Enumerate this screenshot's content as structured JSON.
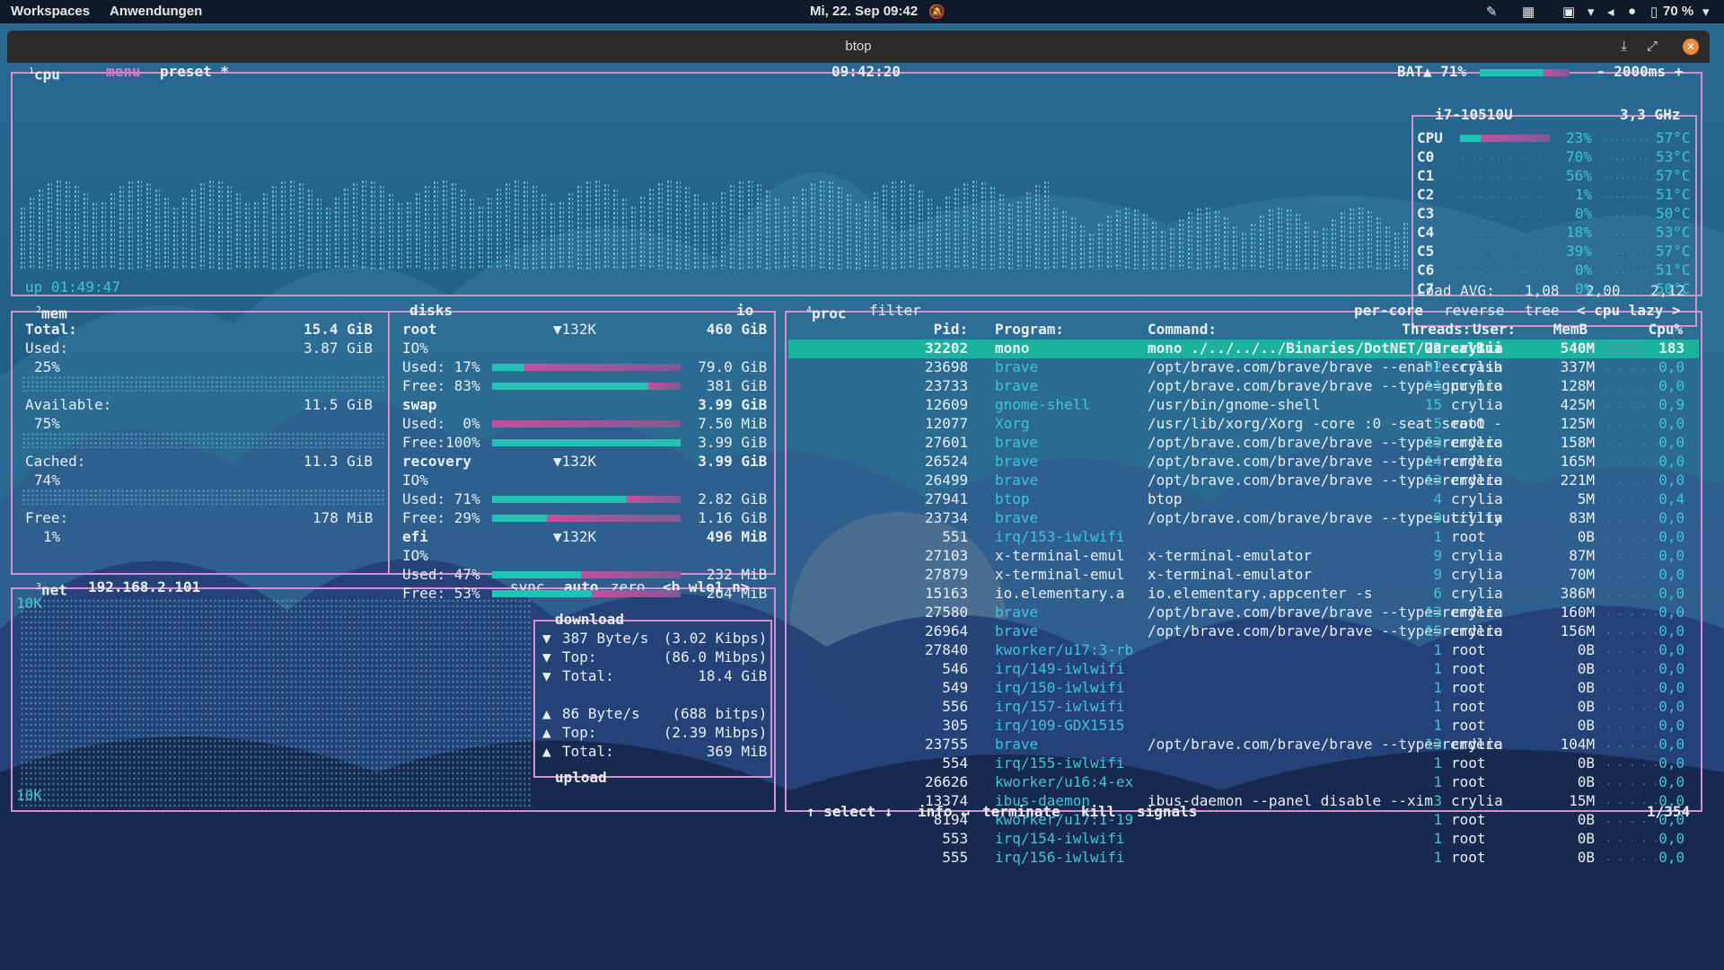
{
  "topbar": {
    "workspaces": "Workspaces",
    "apps": "Anwendungen",
    "clock": "Mi, 22. Sep  09:42",
    "battery": "70 %"
  },
  "window": {
    "title": "btop"
  },
  "cpu": {
    "tabs": [
      "cpu",
      "menu",
      "preset *"
    ],
    "tab_number": "1",
    "time": "09:42:20",
    "battery": "BAT▲ 71%",
    "refresh": "- 2000ms +",
    "uptime": "up 01:49:47",
    "model": "i7-10510U",
    "freq": "3,3 GHz",
    "cores": [
      {
        "name": "CPU",
        "pct": "23%",
        "temp": "57°C"
      },
      {
        "name": "C0",
        "pct": "70%",
        "temp": "53°C"
      },
      {
        "name": "C1",
        "pct": "56%",
        "temp": "57°C"
      },
      {
        "name": "C2",
        "pct": "1%",
        "temp": "51°C"
      },
      {
        "name": "C3",
        "pct": "0%",
        "temp": "50°C"
      },
      {
        "name": "C4",
        "pct": "18%",
        "temp": "53°C"
      },
      {
        "name": "C5",
        "pct": "39%",
        "temp": "57°C"
      },
      {
        "name": "C6",
        "pct": "0%",
        "temp": "51°C"
      },
      {
        "name": "C7",
        "pct": "0%",
        "temp": "50°C"
      }
    ],
    "load_label": "Load AVG:",
    "load": [
      "1,08",
      "2,00",
      "2,12"
    ]
  },
  "mem": {
    "title": "mem",
    "num": "2",
    "total_label": "Total:",
    "total": "15.4 GiB",
    "used_label": "Used:",
    "used": "3.87 GiB",
    "used_pct": "25%",
    "avail_label": "Available:",
    "avail": "11.5 GiB",
    "avail_pct": "75%",
    "cached_label": "Cached:",
    "cached": "11.3 GiB",
    "cached_pct": "74%",
    "free_label": "Free:",
    "free": "178 MiB",
    "free_pct": "1%"
  },
  "disks": {
    "title": "disks",
    "io": "io",
    "items": [
      {
        "name": "root",
        "io_val": "▼132K",
        "size": "460 GiB",
        "io": "IO%",
        "used": "Used: 17%",
        "used_val": "79.0 GiB",
        "used_f": 0.17,
        "free": "Free: 83%",
        "free_val": "381 GiB",
        "free_f": 0.83
      },
      {
        "name": "swap",
        "io_val": "",
        "size": "3.99 GiB",
        "io": "",
        "used": "Used:  0%",
        "used_val": "7.50 MiB",
        "used_f": 0.0,
        "free": "Free:100%",
        "free_val": "3.99 GiB",
        "free_f": 1.0
      },
      {
        "name": "recovery",
        "io_val": "▼132K",
        "size": "3.99 GiB",
        "io": "IO%",
        "used": "Used: 71%",
        "used_val": "2.82 GiB",
        "used_f": 0.71,
        "free": "Free: 29%",
        "free_val": "1.16 GiB",
        "free_f": 0.29
      },
      {
        "name": "efi",
        "io_val": "▼132K",
        "size": "496 MiB",
        "io": "IO%",
        "used": "Used: 47%",
        "used_val": "232 MiB",
        "used_f": 0.47,
        "free": "Free: 53%",
        "free_val": "264 MiB",
        "free_f": 0.53
      }
    ]
  },
  "net": {
    "title": "net",
    "num": "3",
    "ip": "192.168.2.101",
    "buttons": [
      "sync",
      "auto",
      "zero",
      "<b wlo1 n>"
    ],
    "scale_top": "10K",
    "scale_bottom": "10K",
    "download_label": "download",
    "dl_rows": [
      {
        "arrow": "▼",
        "k": "387 Byte/s",
        "v": "(3.02 Kibps)"
      },
      {
        "arrow": "▼",
        "k": "Top:",
        "v": "(86.0 Mibps)"
      },
      {
        "arrow": "▼",
        "k": "Total:",
        "v": "18.4 GiB"
      }
    ],
    "ul_rows": [
      {
        "arrow": "▲",
        "k": "86 Byte/s",
        "v": "(688 bitps)"
      },
      {
        "arrow": "▲",
        "k": "Top:",
        "v": "(2.39 Mibps)"
      },
      {
        "arrow": "▲",
        "k": "Total:",
        "v": "369 MiB"
      }
    ],
    "upload_label": "upload"
  },
  "proc": {
    "title": "proc",
    "num": "4",
    "filter": "filter",
    "options": [
      "per-core",
      "reverse",
      "tree",
      "< cpu lazy >"
    ],
    "headers": {
      "pid": "Pid:",
      "program": "Program:",
      "command": "Command:",
      "threads": "Threads:",
      "user": "User:",
      "mem": "MemB",
      "cpu": "Cpu%"
    },
    "rows": [
      {
        "pid": "32202",
        "prog": "mono",
        "cmd": "mono ./../../../Binaries/DotNET/UnrealBui",
        "thr": "22",
        "user": "crylia",
        "mem": "540M",
        "cpu": "183"
      },
      {
        "pid": "23698",
        "prog": "brave",
        "cmd": "/opt/brave.com/brave/brave --enable-crash",
        "thr": "32",
        "user": "crylia",
        "mem": "337M",
        "cpu": "0,0"
      },
      {
        "pid": "23733",
        "prog": "brave",
        "cmd": "/opt/brave.com/brave/brave --type=gpu-pro",
        "thr": "11",
        "user": "crylia",
        "mem": "128M",
        "cpu": "0,0"
      },
      {
        "pid": "12609",
        "prog": "gnome-shell",
        "cmd": "/usr/bin/gnome-shell",
        "thr": "15",
        "user": "crylia",
        "mem": "425M",
        "cpu": "0,9"
      },
      {
        "pid": "12077",
        "prog": "Xorg",
        "cmd": "/usr/lib/xorg/Xorg -core :0 -seat seat0 -",
        "thr": "5",
        "user": "root",
        "mem": "125M",
        "cpu": "0,0"
      },
      {
        "pid": "27601",
        "prog": "brave",
        "cmd": "/opt/brave.com/brave/brave --type=rendere",
        "thr": "13",
        "user": "crylia",
        "mem": "158M",
        "cpu": "0,0"
      },
      {
        "pid": "26524",
        "prog": "brave",
        "cmd": "/opt/brave.com/brave/brave --type=rendere",
        "thr": "14",
        "user": "crylia",
        "mem": "165M",
        "cpu": "0,0"
      },
      {
        "pid": "26499",
        "prog": "brave",
        "cmd": "/opt/brave.com/brave/brave --type=rendere",
        "thr": "13",
        "user": "crylia",
        "mem": "221M",
        "cpu": "0,0"
      },
      {
        "pid": "27941",
        "prog": "btop",
        "cmd": "btop",
        "thr": "4",
        "user": "crylia",
        "mem": "5M",
        "cpu": "0,4"
      },
      {
        "pid": "23734",
        "prog": "brave",
        "cmd": "/opt/brave.com/brave/brave --type=utility",
        "thr": "9",
        "user": "crylia",
        "mem": "83M",
        "cpu": "0,0"
      },
      {
        "pid": "551",
        "prog": "irq/153-iwlwifi",
        "cmd": "",
        "thr": "1",
        "user": "root",
        "mem": "0B",
        "cpu": "0,0"
      },
      {
        "pid": "27103",
        "prog": "x-terminal-emul",
        "cmd": "x-terminal-emulator",
        "thr": "9",
        "user": "crylia",
        "mem": "87M",
        "cpu": "0,0"
      },
      {
        "pid": "27879",
        "prog": "x-terminal-emul",
        "cmd": "x-terminal-emulator",
        "thr": "9",
        "user": "crylia",
        "mem": "70M",
        "cpu": "0,0"
      },
      {
        "pid": "15163",
        "prog": "io.elementary.a",
        "cmd": "io.elementary.appcenter -s",
        "thr": "6",
        "user": "crylia",
        "mem": "386M",
        "cpu": "0,0"
      },
      {
        "pid": "27580",
        "prog": "brave",
        "cmd": "/opt/brave.com/brave/brave --type=rendere",
        "thr": "13",
        "user": "crylia",
        "mem": "160M",
        "cpu": "0,0"
      },
      {
        "pid": "26964",
        "prog": "brave",
        "cmd": "/opt/brave.com/brave/brave --type=rendere",
        "thr": "15",
        "user": "crylia",
        "mem": "156M",
        "cpu": "0,0"
      },
      {
        "pid": "27840",
        "prog": "kworker/u17:3-rb",
        "cmd": "",
        "thr": "1",
        "user": "root",
        "mem": "0B",
        "cpu": "0,0"
      },
      {
        "pid": "546",
        "prog": "irq/149-iwlwifi",
        "cmd": "",
        "thr": "1",
        "user": "root",
        "mem": "0B",
        "cpu": "0,0"
      },
      {
        "pid": "549",
        "prog": "irq/150-iwlwifi",
        "cmd": "",
        "thr": "1",
        "user": "root",
        "mem": "0B",
        "cpu": "0,0"
      },
      {
        "pid": "556",
        "prog": "irq/157-iwlwifi",
        "cmd": "",
        "thr": "1",
        "user": "root",
        "mem": "0B",
        "cpu": "0,0"
      },
      {
        "pid": "305",
        "prog": "irq/109-GDX1515",
        "cmd": "",
        "thr": "1",
        "user": "root",
        "mem": "0B",
        "cpu": "0,0"
      },
      {
        "pid": "23755",
        "prog": "brave",
        "cmd": "/opt/brave.com/brave/brave --type=rendere",
        "thr": "13",
        "user": "crylia",
        "mem": "104M",
        "cpu": "0,0"
      },
      {
        "pid": "554",
        "prog": "irq/155-iwlwifi",
        "cmd": "",
        "thr": "1",
        "user": "root",
        "mem": "0B",
        "cpu": "0,0"
      },
      {
        "pid": "26626",
        "prog": "kworker/u16:4-ex",
        "cmd": "",
        "thr": "1",
        "user": "root",
        "mem": "0B",
        "cpu": "0,0"
      },
      {
        "pid": "13374",
        "prog": "ibus-daemon",
        "cmd": "ibus-daemon --panel disable --xim",
        "thr": "3",
        "user": "crylia",
        "mem": "15M",
        "cpu": "0,0"
      },
      {
        "pid": "8194",
        "prog": "kworker/u17:1-19",
        "cmd": "",
        "thr": "1",
        "user": "root",
        "mem": "0B",
        "cpu": "0,0"
      },
      {
        "pid": "553",
        "prog": "irq/154-iwlwifi",
        "cmd": "",
        "thr": "1",
        "user": "root",
        "mem": "0B",
        "cpu": "0,0"
      },
      {
        "pid": "555",
        "prog": "irq/156-iwlwifi",
        "cmd": "",
        "thr": "1",
        "user": "root",
        "mem": "0B",
        "cpu": "0,0"
      }
    ],
    "footer": [
      "↑ select ↓",
      "info ↵",
      "terminate",
      "kill",
      "signals"
    ],
    "count": "1/354"
  },
  "colors": {
    "accent": "#3ec6d6",
    "border": "#d490cc",
    "selected": "#1ab39e",
    "dim_text": "#8aa1b2"
  }
}
